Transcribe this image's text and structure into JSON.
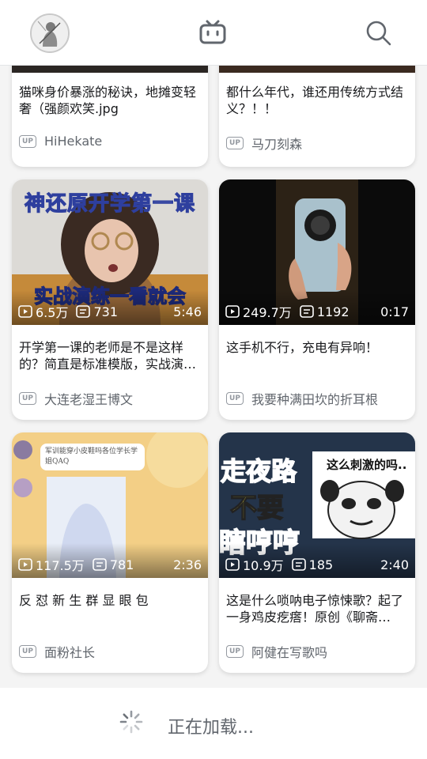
{
  "header": {
    "avatar_icon": "avatar",
    "logo_icon": "tv-logo-icon",
    "search_icon": "search-icon"
  },
  "cards": [
    {
      "title": "猫咪身价暴涨的秘诀，地摊变轻奢（强颜欢笑.jpg",
      "author": "HiHekate"
    },
    {
      "title": "都什么年代，谁还用传统方式结义？！！",
      "author": "马刀刻森"
    },
    {
      "title": "开学第一课的老师是不是这样的？简直是标准模版，实战演…",
      "author": "大连老湿王博文",
      "views": "6.5万",
      "danmaku": "731",
      "duration": "5:46",
      "overlay_top": "神还原开学第一课",
      "overlay_bottom": "实战演练一看就会"
    },
    {
      "title": "这手机不行，充电有异响！",
      "author": "我要种满田坎的折耳根",
      "views": "249.7万",
      "danmaku": "1192",
      "duration": "0:17"
    },
    {
      "title": "反 怼 新 生 群 显 眼 包",
      "author": "面粉社长",
      "views": "117.5万",
      "danmaku": "781",
      "duration": "2:36",
      "chat_text": "军训能穿小皮鞋吗各位学长学姐QAQ"
    },
    {
      "title": "这是什么唢呐电子惊悚歌？起了一身鸡皮疙瘩！原创《聊斋…",
      "author": "阿健在写歌吗",
      "views": "10.9万",
      "danmaku": "185",
      "duration": "2:40",
      "overlay_line1": "走夜路",
      "overlay_line2": "不要",
      "overlay_line3": "瞎哼哼",
      "meme_text": "这么刺激的吗.."
    }
  ],
  "up_badge": "UP",
  "loading": {
    "text": "正在加载..."
  },
  "colors": {
    "accent": "#fb7299",
    "text": "#18191c",
    "secondary": "#61666d",
    "icon": "#9499a0"
  }
}
